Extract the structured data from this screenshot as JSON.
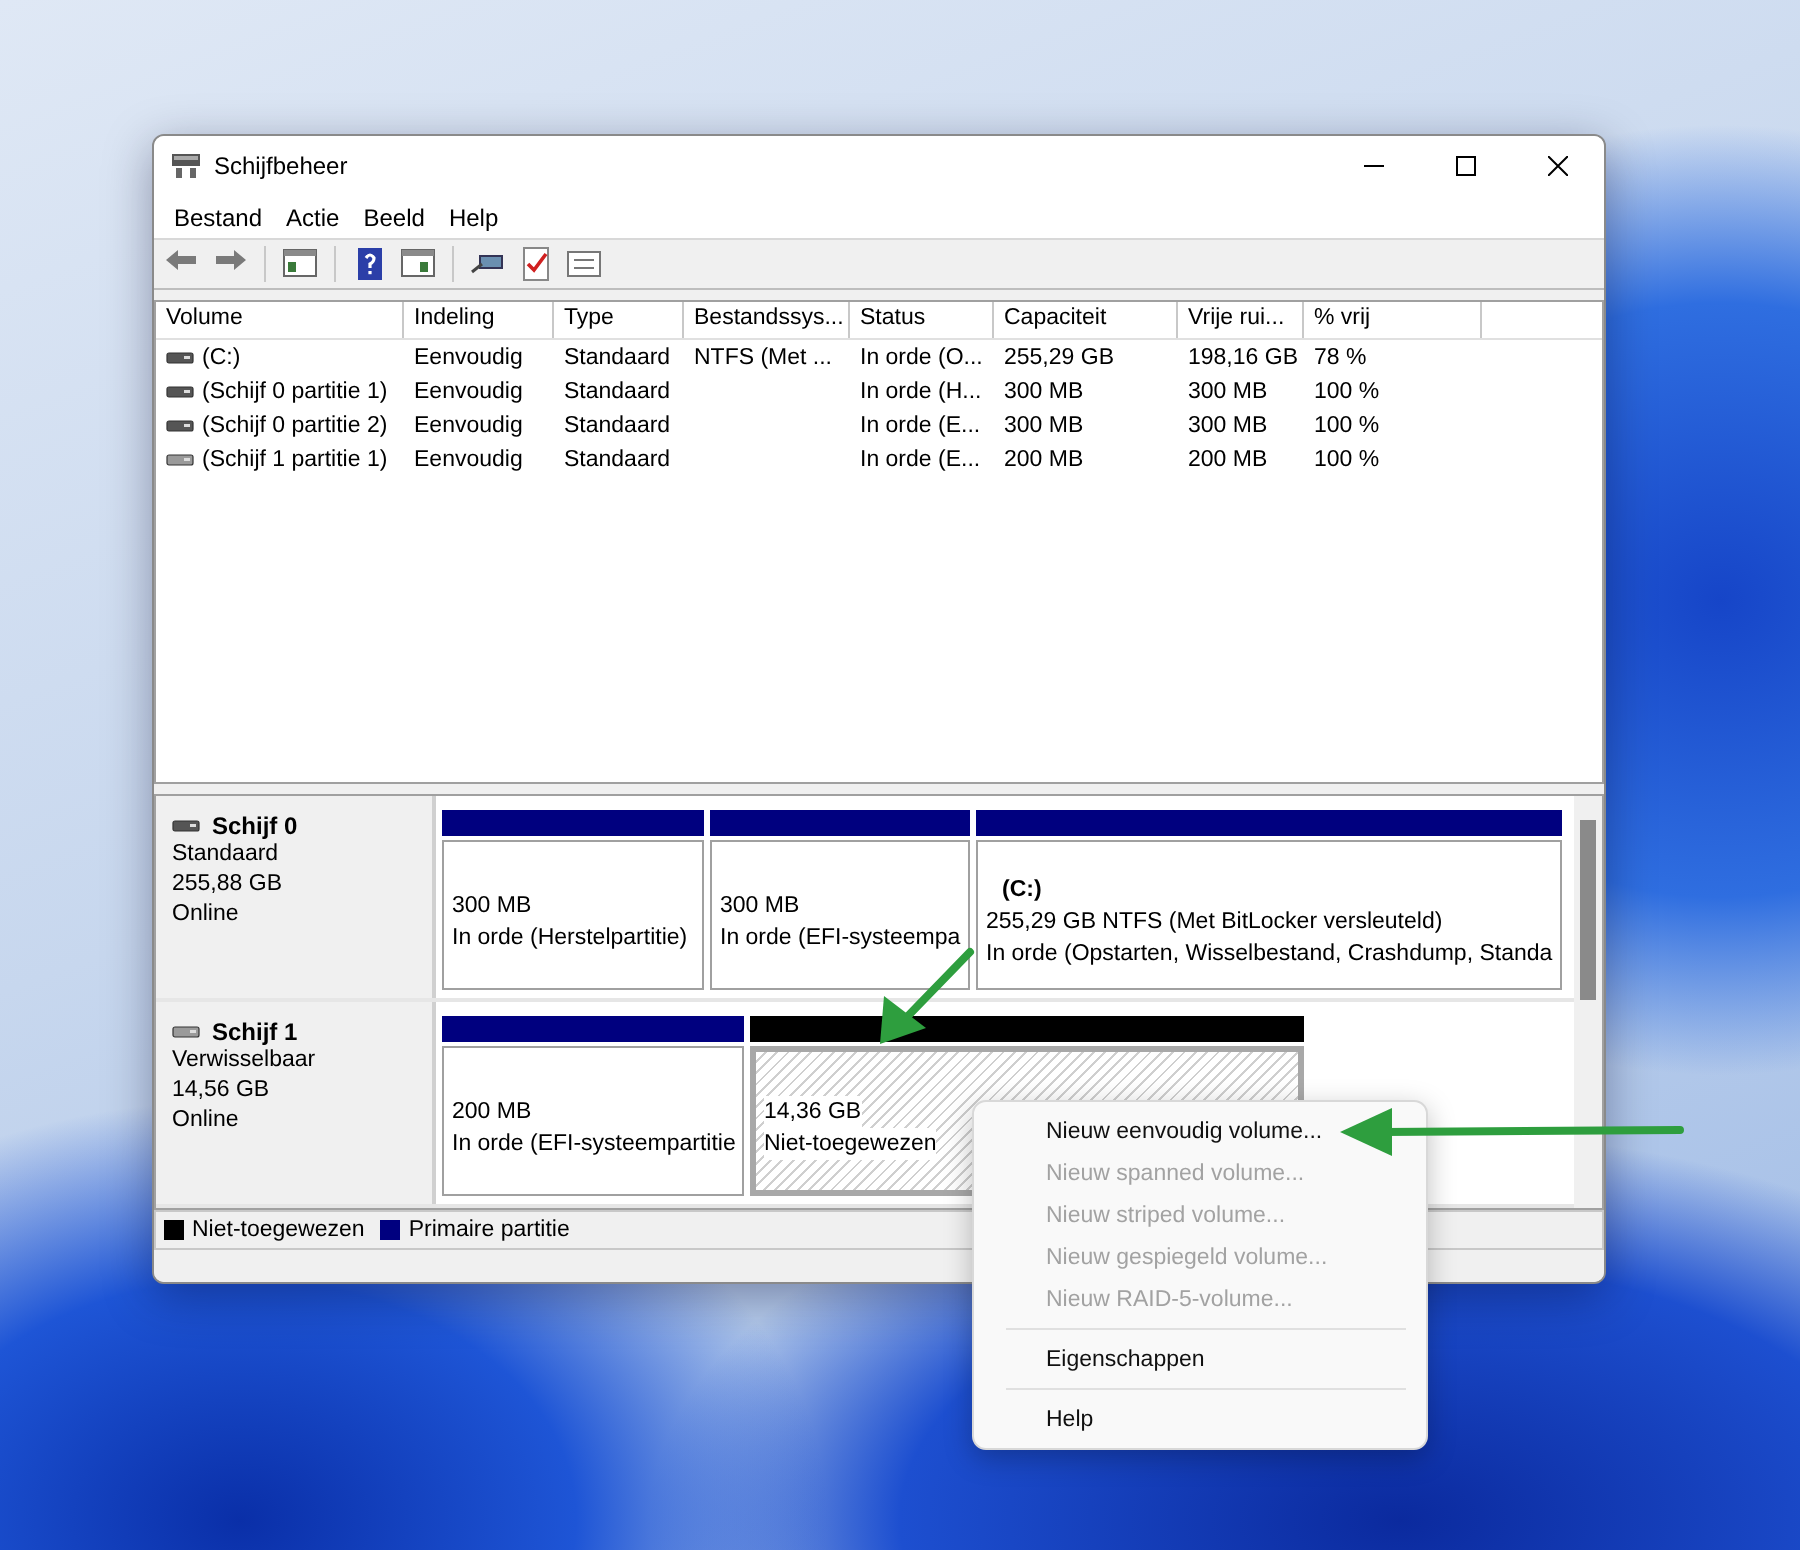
{
  "window": {
    "title": "Schijfbeheer"
  },
  "menu": [
    "Bestand",
    "Actie",
    "Beeld",
    "Help"
  ],
  "table": {
    "columns": [
      "Volume",
      "Indeling",
      "Type",
      "Bestandssys...",
      "Status",
      "Capaciteit",
      "Vrije rui...",
      "% vrij"
    ],
    "rows": [
      {
        "cells": [
          "(C:)",
          "Eenvoudig",
          "Standaard",
          "NTFS (Met ...",
          "In orde (O...",
          "255,29 GB",
          "198,16 GB",
          "78 %"
        ]
      },
      {
        "cells": [
          "(Schijf 0 partitie 1)",
          "Eenvoudig",
          "Standaard",
          null,
          "In orde (H...",
          "300 MB",
          "300 MB",
          "100 %"
        ]
      },
      {
        "cells": [
          "(Schijf 0 partitie 2)",
          "Eenvoudig",
          "Standaard",
          null,
          "In orde (E...",
          "300 MB",
          "300 MB",
          "100 %"
        ]
      },
      {
        "cells": [
          "(Schijf 1 partitie 1)",
          "Eenvoudig",
          "Standaard",
          null,
          "In orde (E...",
          "200 MB",
          "200 MB",
          "100 %"
        ]
      }
    ]
  },
  "disks": [
    {
      "name": "Schijf 0",
      "type": "Standaard",
      "size": "255,88 GB",
      "status": "Online",
      "partitions": [
        {
          "kind": "primary",
          "selected": false,
          "size_line": "300 MB",
          "status_line": "In orde (Herstelpartitie)"
        },
        {
          "kind": "primary",
          "selected": false,
          "size_line": "300 MB",
          "status_line": "In orde (EFI-systeempa"
        },
        {
          "kind": "primary",
          "selected": false,
          "label": "(C:)",
          "size_line": "255,29 GB NTFS (Met BitLocker versleuteld)",
          "status_line": "In orde (Opstarten, Wisselbestand, Crashdump, Standa"
        }
      ]
    },
    {
      "name": "Schijf 1",
      "type": "Verwisselbaar",
      "size": "14,56 GB",
      "status": "Online",
      "partitions": [
        {
          "kind": "primary",
          "selected": false,
          "size_line": "200 MB",
          "status_line": "In orde (EFI-systeempartitie"
        },
        {
          "kind": "unallocated",
          "selected": true,
          "size_line": "14,36 GB",
          "status_line": "Niet-toegewezen"
        }
      ]
    }
  ],
  "legend": [
    {
      "label": "Niet-toegewezen",
      "color": "#000000"
    },
    {
      "label": "Primaire partitie",
      "color": "#00007f"
    }
  ],
  "context_menu": {
    "items": [
      {
        "kind": "item",
        "label": "Nieuw eenvoudig volume...",
        "disabled": false
      },
      {
        "kind": "item",
        "label": "Nieuw spanned volume...",
        "disabled": true
      },
      {
        "kind": "item",
        "label": "Nieuw striped volume...",
        "disabled": true
      },
      {
        "kind": "item",
        "label": "Nieuw gespiegeld volume...",
        "disabled": true
      },
      {
        "kind": "item",
        "label": "Nieuw RAID-5-volume...",
        "disabled": true
      },
      {
        "kind": "separator"
      },
      {
        "kind": "item",
        "label": "Eigenschappen",
        "disabled": false
      },
      {
        "kind": "separator"
      },
      {
        "kind": "item",
        "label": "Help",
        "disabled": false
      }
    ]
  }
}
